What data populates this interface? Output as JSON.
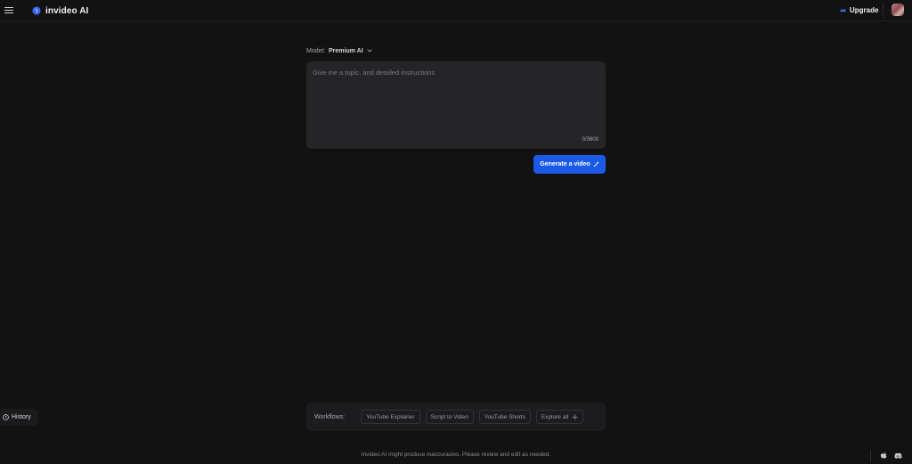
{
  "header": {
    "brand_name": "invideo AI",
    "upgrade_label": "Upgrade"
  },
  "composer": {
    "model_label": "Model:",
    "model_value": "Premium AI",
    "prompt_placeholder": "Give me a topic, and detailed instructions",
    "char_count": "0/3600",
    "generate_label": "Generate a video"
  },
  "sidebar": {
    "history_label": "History"
  },
  "workflows": {
    "label": "Workflows:",
    "items": [
      "YouTube Explainer",
      "Script to Video",
      "YouTube Shorts"
    ],
    "explore_label": "Explore all"
  },
  "footer": {
    "disclaimer": "Invideo AI might produce inaccuracies. Please review and edit as needed."
  },
  "colors": {
    "background": "#121213",
    "accent": "#1a5ae6",
    "surface": "#252527"
  },
  "icons": [
    "menu-icon",
    "invideo-logo-icon",
    "upgrade-spark-icon",
    "chevron-down-icon",
    "sparkle-icon",
    "clock-icon",
    "plus-icon",
    "apple-icon",
    "discord-icon"
  ]
}
